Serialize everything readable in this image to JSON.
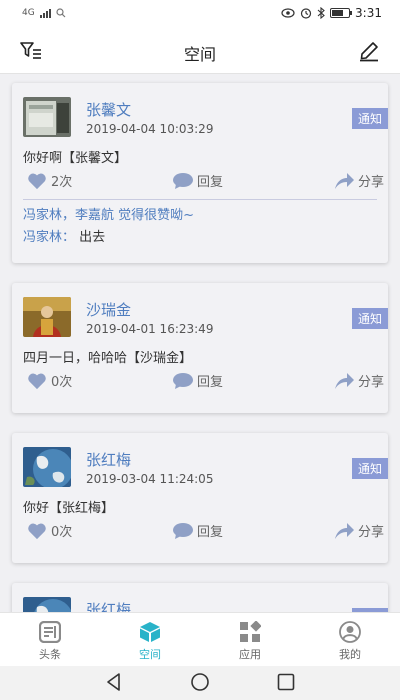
{
  "status": {
    "time": "3:31",
    "signal": "4G"
  },
  "header": {
    "title": "空间"
  },
  "badge_label": "通知",
  "posts": [
    {
      "author": "张馨文",
      "time": "2019-04-04 10:03:29",
      "content": "你好啊【张馨文】",
      "likes": "2次",
      "reply_label": "回复",
      "share_label": "分享",
      "liked_by": "冯家林，李嘉航 觉得很赞呦~",
      "comment": {
        "name": "冯家林：",
        "text": " 出去"
      }
    },
    {
      "author": "沙瑞金",
      "time": "2019-04-01 16:23:49",
      "content": "四月一日，哈哈哈【沙瑞金】",
      "likes": "0次",
      "reply_label": "回复",
      "share_label": "分享"
    },
    {
      "author": "张红梅",
      "time": "2019-03-04 11:24:05",
      "content": "你好【张红梅】",
      "likes": "0次",
      "reply_label": "回复",
      "share_label": "分享"
    },
    {
      "author": "张红梅"
    }
  ],
  "tabs": [
    {
      "label": "头条",
      "icon": "news-icon",
      "active": false
    },
    {
      "label": "空间",
      "icon": "cube-icon",
      "active": true
    },
    {
      "label": "应用",
      "icon": "apps-grid-icon",
      "active": false
    },
    {
      "label": "我的",
      "icon": "user-icon",
      "active": false
    }
  ],
  "colors": {
    "accent": "#29b3c9",
    "link": "#4f7dbf",
    "badge": "#8b9bd6"
  }
}
